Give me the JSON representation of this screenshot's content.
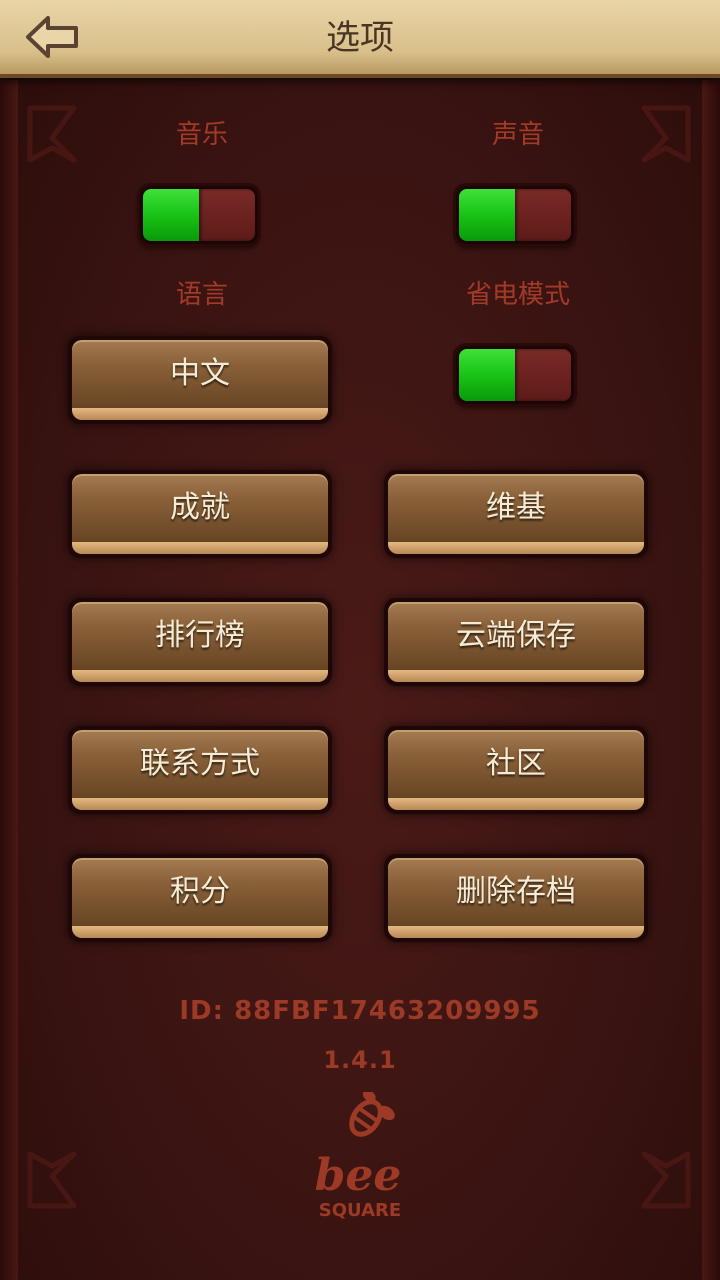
{
  "header": {
    "title": "选项",
    "back_icon": "back-arrow-icon"
  },
  "settings": {
    "music_label": "音乐",
    "sound_label": "声音",
    "language_label": "语言",
    "power_save_label": "省电模式",
    "music_on": true,
    "sound_on": true,
    "power_save_on": true
  },
  "buttons": {
    "language": "中文",
    "achievements": "成就",
    "wiki": "维基",
    "leaderboard": "排行榜",
    "cloud_save": "云端保存",
    "contact": "联系方式",
    "community": "社区",
    "points": "积分",
    "delete_save": "删除存档"
  },
  "footer": {
    "id": "ID: 88FBF17463209995",
    "version": "1.4.1",
    "logo_text_top": "bee",
    "logo_text_bottom": "SQUARE"
  },
  "colors": {
    "header_bg": "#d9c08b",
    "panel_bg": "#3a1412",
    "label_red": "#a33a28",
    "toggle_green": "#19c316",
    "button_brown": "#8a6139"
  }
}
